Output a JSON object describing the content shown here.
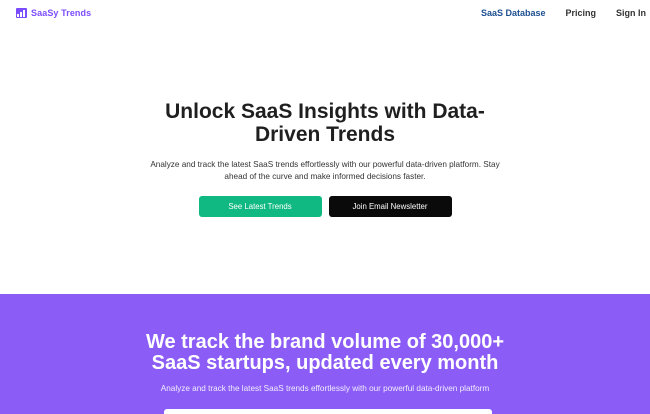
{
  "brand": {
    "name": "SaaSy Trends",
    "icon": "bar-chart-icon",
    "color": "#7c4dff"
  },
  "nav": {
    "items": [
      {
        "label": "SaaS Database"
      },
      {
        "label": "Pricing"
      },
      {
        "label": "Sign In"
      }
    ]
  },
  "hero": {
    "title": "Unlock SaaS Insights with Data-Driven Trends",
    "description": "Analyze and track the latest SaaS trends effortlessly with our powerful data-driven platform. Stay ahead of the curve and make informed decisions faster.",
    "primary_button": "See Latest Trends",
    "secondary_button": "Join Email Newsletter"
  },
  "band": {
    "title": "We track the brand volume of 30,000+ SaaS startups, updated every month",
    "description": "Analyze and track the latest SaaS trends effortlessly with our powerful data-driven platform"
  },
  "colors": {
    "accent": "#7c4dff",
    "primary_button": "#10b981",
    "secondary_button": "#0a0a0a",
    "band_background": "#8b5cf6"
  }
}
